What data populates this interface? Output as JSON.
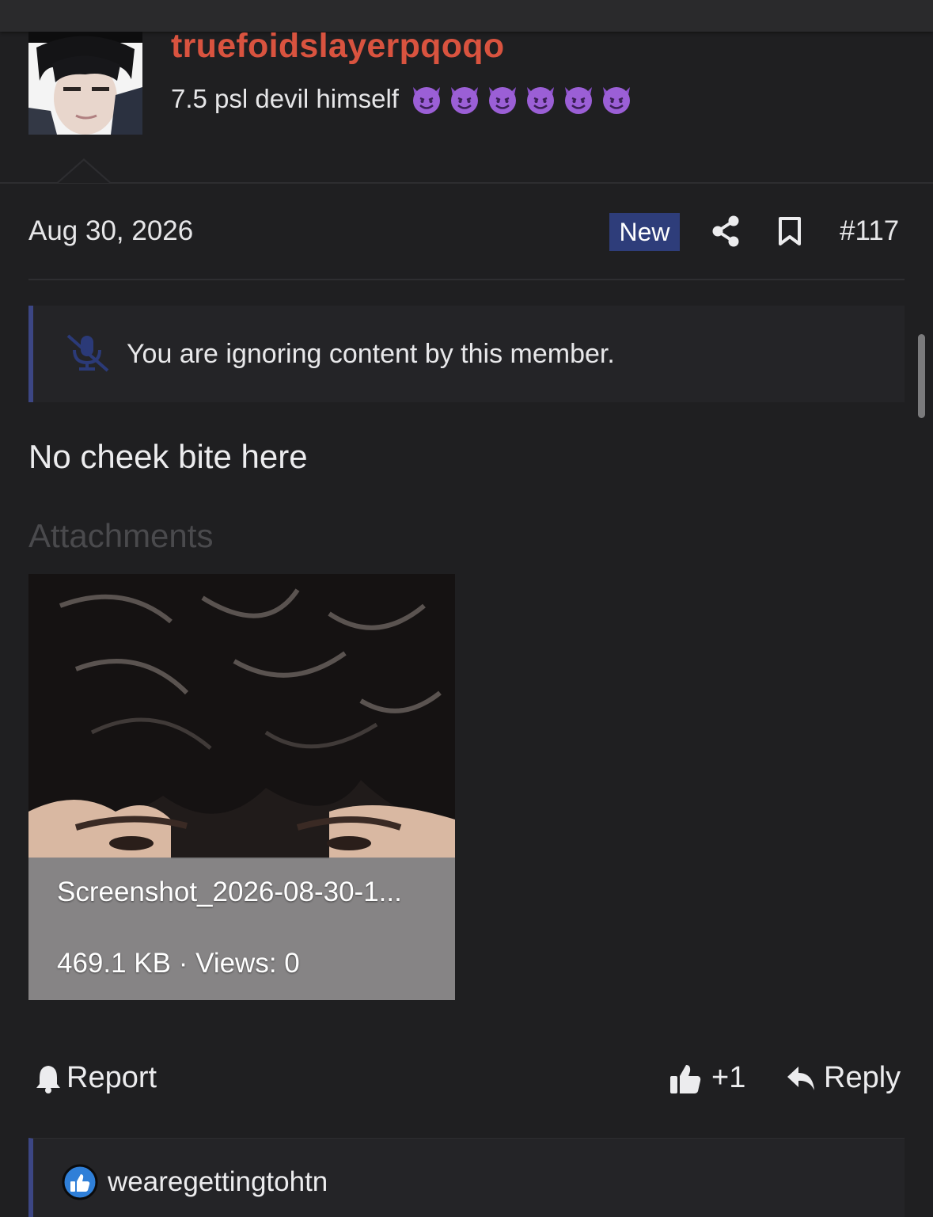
{
  "user": {
    "username": "truefoidslayerpqoqo",
    "title": "7.5 psl devil himself",
    "title_emojis": [
      "smiling-devil",
      "smiling-devil",
      "smiling-devil",
      "smiling-devil",
      "smiling-devil",
      "smiling-devil"
    ]
  },
  "post": {
    "date": "Aug 30, 2026",
    "new_badge": "New",
    "number": "#117",
    "ignored_notice": "You are ignoring content by this member.",
    "body": "No cheek bite here",
    "attachments_label": "Attachments",
    "attachment": {
      "filename": "Screenshot_2026-08-30-1...",
      "meta": "469.1 KB · Views: 0"
    }
  },
  "actions": {
    "report": "Report",
    "like_count": "+1",
    "reply": "Reply"
  },
  "reactions": {
    "user": "wearegettingtohtn"
  },
  "colors": {
    "username": "#d9533f",
    "accent_bar": "#3c4684",
    "new_badge_bg": "#2e3d7a",
    "like_icon_bg": "#2f7fd8"
  }
}
